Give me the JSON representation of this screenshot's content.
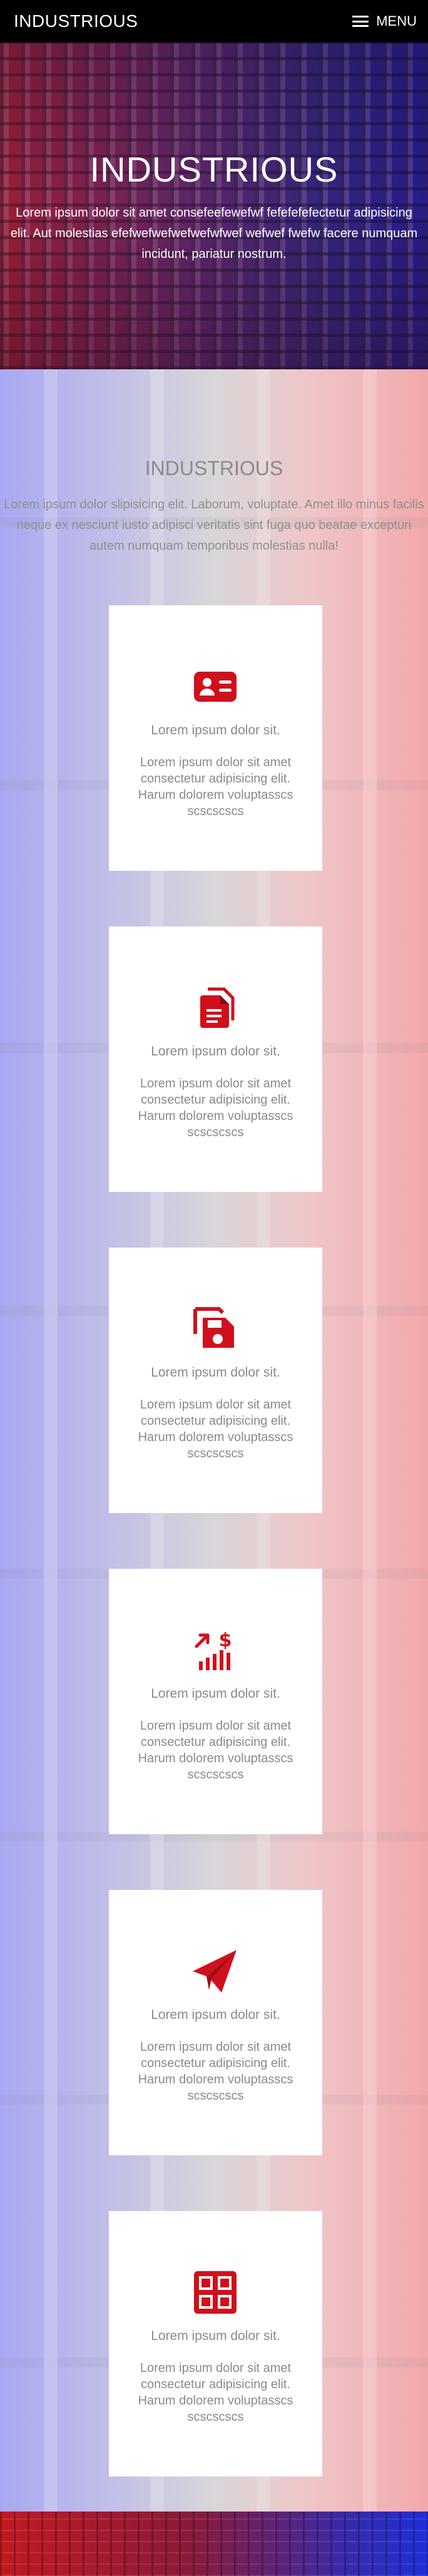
{
  "header": {
    "brand": "INDUSTRIOUS",
    "menu_label": "MENU"
  },
  "hero": {
    "title": "INDUSTRIOUS",
    "text": "Lorem ipsum dolor sit amet consefeefewefwf fefefefefectetur adipisicing elit. Aut molestias efefwefwefwefwefwfwef wefwef fwefw facere numquam incidunt, pariatur nostrum."
  },
  "features": {
    "title": "INDUSTRIOUS",
    "text": "Lorem ipsum dolor slipisicing elit. Laborum, voluptate. Amet illo minus facilis neque ex nesciunt iusto adipisci veritatis sint fuga quo beatae excepturi autem numquam temporibus molestias nulla!",
    "cards": [
      {
        "icon": "id-card-icon",
        "title": "Lorem ipsum dolor sit.",
        "text": "Lorem ipsum dolor sit amet consectetur adipisicing elit. Harum dolorem voluptasscs scscscscs"
      },
      {
        "icon": "documents-icon",
        "title": "Lorem ipsum dolor sit.",
        "text": "Lorem ipsum dolor sit amet consectetur adipisicing elit. Harum dolorem voluptasscs scscscscs"
      },
      {
        "icon": "save-files-icon",
        "title": "Lorem ipsum dolor sit.",
        "text": "Lorem ipsum dolor sit amet consectetur adipisicing elit. Harum dolorem voluptasscs scscscscs"
      },
      {
        "icon": "growth-chart-icon",
        "title": "Lorem ipsum dolor sit.",
        "text": "Lorem ipsum dolor sit amet consectetur adipisicing elit. Harum dolorem voluptasscs scscscscs"
      },
      {
        "icon": "paper-plane-icon",
        "title": "Lorem ipsum dolor sit.",
        "text": "Lorem ipsum dolor sit amet consectetur adipisicing elit. Harum dolorem voluptasscs scscscscs"
      },
      {
        "icon": "grid-box-icon",
        "title": "Lorem ipsum dolor sit.",
        "text": "Lorem ipsum dolor sit amet consectetur adipisicing elit. Harum dolorem voluptasscs scscscscs"
      }
    ]
  },
  "colors": {
    "header_bg": "#000000",
    "icon_red": "#d0101c",
    "card_text": "#8a8a8a"
  }
}
